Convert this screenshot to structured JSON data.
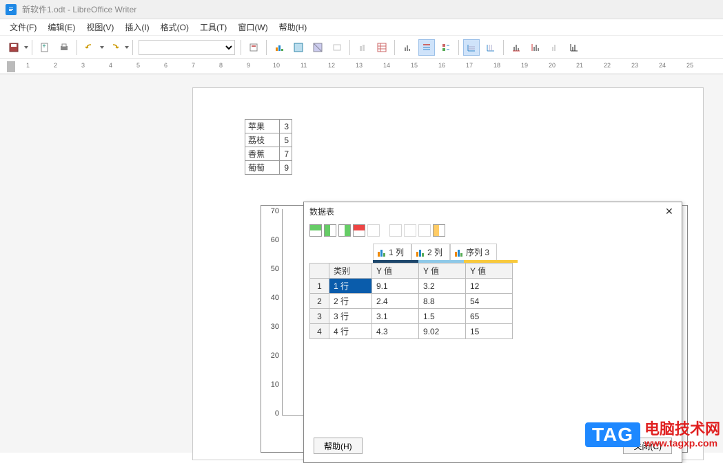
{
  "title": "新软件1.odt - LibreOffice Writer",
  "menu": [
    {
      "label": "文件(F)"
    },
    {
      "label": "编辑(E)"
    },
    {
      "label": "视图(V)"
    },
    {
      "label": "插入(I)"
    },
    {
      "label": "格式(O)"
    },
    {
      "label": "工具(T)"
    },
    {
      "label": "窗口(W)"
    },
    {
      "label": "帮助(H)"
    }
  ],
  "ruler_marks": [
    "1",
    "2",
    "3",
    "4",
    "5",
    "6",
    "7",
    "8",
    "9",
    "10",
    "11",
    "12",
    "13",
    "14",
    "15",
    "16",
    "17",
    "18",
    "19",
    "20",
    "21",
    "22",
    "23",
    "24",
    "25"
  ],
  "inline_table": [
    {
      "name": "苹果",
      "val": "3"
    },
    {
      "name": "荔枝",
      "val": "5"
    },
    {
      "name": "香蕉",
      "val": "7"
    },
    {
      "name": "葡萄",
      "val": "9"
    }
  ],
  "chart_data": {
    "type": "bar",
    "title": "数据表",
    "xlabel": "",
    "ylabel": "",
    "ylim": [
      0,
      70
    ],
    "y_ticks": [
      0,
      10,
      20,
      30,
      40,
      50,
      60,
      70
    ],
    "categories": [
      "1 行",
      "2 行",
      "3 行",
      "4 行"
    ],
    "series": [
      {
        "name": "1 列",
        "values": [
          9.1,
          2.4,
          3.1,
          4.3
        ],
        "color": "#1c466b"
      },
      {
        "name": "2 列",
        "values": [
          3.2,
          8.8,
          1.5,
          9.02
        ],
        "color": "#8ec9e8"
      },
      {
        "name": "序列 3",
        "values": [
          12,
          54,
          65,
          15
        ],
        "color": "#f8c93c"
      }
    ]
  },
  "dialog": {
    "title": "数据表",
    "series_tabs": [
      "1 列",
      "2 列",
      "序列 3"
    ],
    "headers": [
      "类别",
      "Y 值",
      "Y 值",
      "Y 值"
    ],
    "rows": [
      {
        "n": "1",
        "cat": "1 行",
        "y1": "9.1",
        "y2": "3.2",
        "y3": "12",
        "sel": true
      },
      {
        "n": "2",
        "cat": "2 行",
        "y1": "2.4",
        "y2": "8.8",
        "y3": "54"
      },
      {
        "n": "3",
        "cat": "3 行",
        "y1": "3.1",
        "y2": "1.5",
        "y3": "65"
      },
      {
        "n": "4",
        "cat": "4 行",
        "y1": "4.3",
        "y2": "9.02",
        "y3": "15"
      }
    ],
    "help_btn": "帮助(H)",
    "close_btn": "关闭(C)"
  },
  "watermark": {
    "tag": "TAG",
    "cn": "电脑技术网",
    "url": "www.tagxp.com"
  }
}
